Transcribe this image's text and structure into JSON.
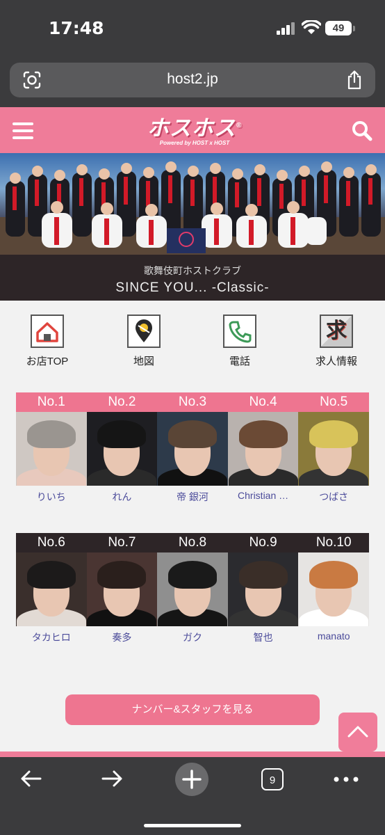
{
  "status": {
    "time": "17:48",
    "battery": "49"
  },
  "browser": {
    "url": "host2.jp",
    "tab_count": "9"
  },
  "header": {
    "logo": "ホスホス",
    "logo_tagline": "Powered by HOST x HOST",
    "registered": "®"
  },
  "shop": {
    "category": "歌舞伎町ホストクラブ",
    "name": "SINCE YOU... -Classic-"
  },
  "nav": [
    {
      "label": "お店TOP",
      "icon": "shop-home-icon"
    },
    {
      "label": "地図",
      "icon": "map-pin-icon"
    },
    {
      "label": "電話",
      "icon": "phone-icon"
    },
    {
      "label": "求人情報",
      "icon": "recruit-icon",
      "glyph": "求"
    }
  ],
  "ranking": [
    {
      "rank": "No.1",
      "name": "りいち"
    },
    {
      "rank": "No.2",
      "name": "れん"
    },
    {
      "rank": "No.3",
      "name": "帝 銀河"
    },
    {
      "rank": "No.4",
      "name": "Christian …"
    },
    {
      "rank": "No.5",
      "name": "つばさ"
    },
    {
      "rank": "No.6",
      "name": "タカヒロ"
    },
    {
      "rank": "No.7",
      "name": "奏多"
    },
    {
      "rank": "No.8",
      "name": "ガク"
    },
    {
      "rank": "No.9",
      "name": "智也"
    },
    {
      "rank": "No.10",
      "name": "manato"
    }
  ],
  "cta": {
    "label": "ナンバー&スタッフを見る"
  },
  "colors": {
    "brand_pink": "#ef7c99",
    "top_rank_header": "#ee7590",
    "lower_rank_header": "#2d2527",
    "name_text": "#4b4b9a"
  }
}
